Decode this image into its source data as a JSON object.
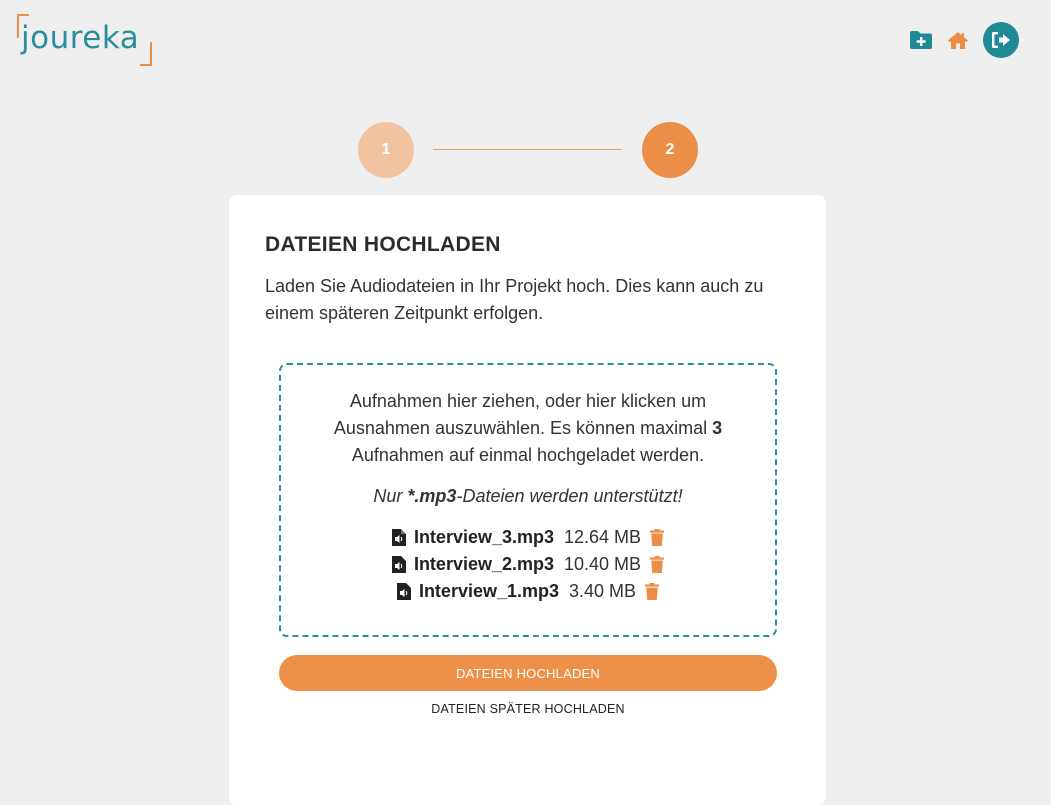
{
  "header": {
    "logo_text": "joureka",
    "icons": [
      "folder-plus-icon",
      "home-icon",
      "logout-icon"
    ],
    "colors": {
      "teal": "#1f8a96",
      "orange": "#eb8e48"
    }
  },
  "stepper": {
    "steps": [
      {
        "label": "1",
        "state": "done"
      },
      {
        "label": "2",
        "state": "active"
      }
    ]
  },
  "upload": {
    "title": "DATEIEN HOCHLADEN",
    "description": "Laden Sie Audiodateien in Ihr Projekt hoch. Dies kann auch zu einem späteren Zeitpunkt erfolgen.",
    "dropzone": {
      "text_before": "Aufnahmen hier ziehen, oder hier klicken um Ausnahmen auszuwählen. Es können maximal ",
      "max_files": "3",
      "text_after": " Aufnahmen auf einmal hochgeladet werden.",
      "note_prefix": "Nur ",
      "note_format": "*.mp3",
      "note_suffix": "-Dateien werden unterstützt!"
    },
    "files": [
      {
        "name": "Interview_3.mp3",
        "size": "12.64 MB"
      },
      {
        "name": "Interview_2.mp3",
        "size": "10.40 MB"
      },
      {
        "name": "Interview_1.mp3",
        "size": "3.40 MB"
      }
    ],
    "primary_button": "DATEIEN HOCHLADEN",
    "secondary_link": "DATEIEN SPÄTER HOCHLADEN"
  }
}
